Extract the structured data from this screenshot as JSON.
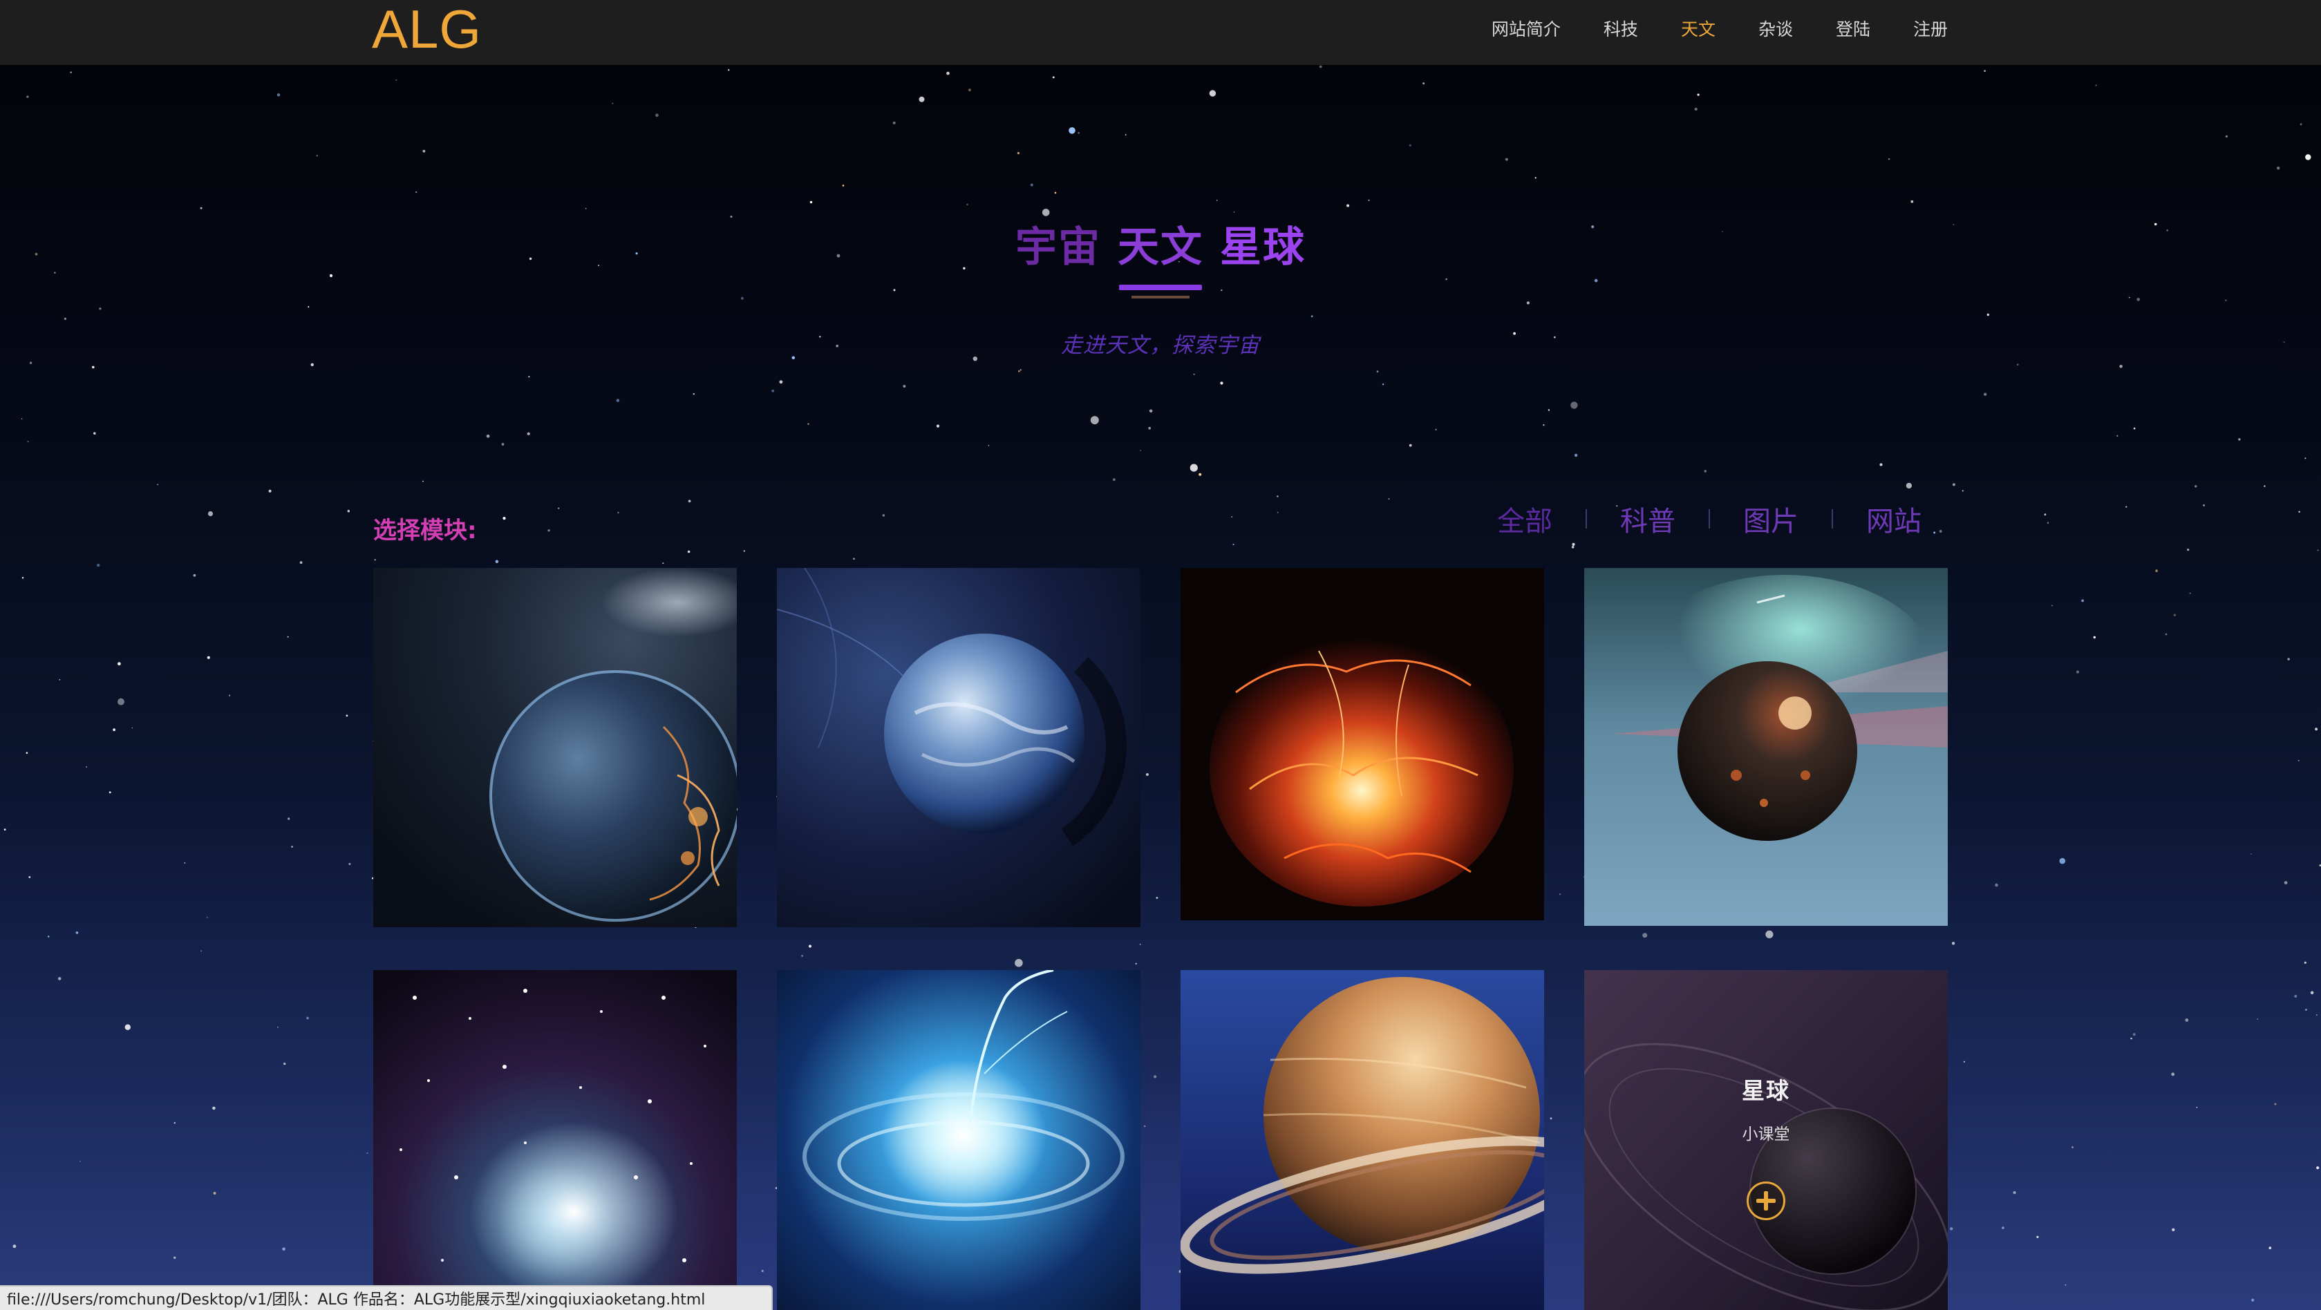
{
  "header": {
    "logo": "ALG",
    "nav": [
      {
        "label": "网站简介",
        "active": false
      },
      {
        "label": "科技",
        "active": false
      },
      {
        "label": "天文",
        "active": true
      },
      {
        "label": "杂谈",
        "active": false
      },
      {
        "label": "登陆",
        "active": false
      },
      {
        "label": "注册",
        "active": false
      }
    ]
  },
  "hero": {
    "title_words": [
      "宇宙",
      "天文",
      "星球"
    ],
    "subtitle": "走进天文，探索宇宙"
  },
  "modules": {
    "label": "选择模块:",
    "filters": [
      "全部",
      "科普",
      "图片",
      "网站"
    ]
  },
  "gallery": {
    "overlay": {
      "title": "星球",
      "subtitle": "小课堂"
    }
  },
  "status_bar": {
    "url": "file:///Users/romchung/Desktop/v1/团队：ALG 作品名：ALG功能展示型/xingqiuxiaoketang.html"
  },
  "colors": {
    "accent": "#f0a73a",
    "header_bg": "#1e1e1e",
    "purple": "#8b3fd8",
    "magenta": "#d43fb4"
  }
}
